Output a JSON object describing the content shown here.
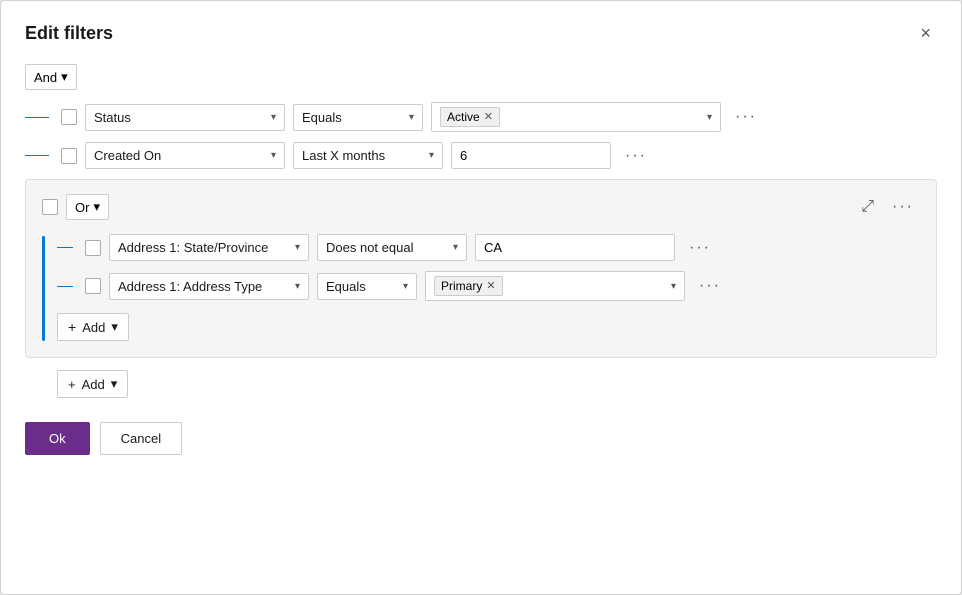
{
  "dialog": {
    "title": "Edit filters",
    "close_label": "×"
  },
  "and_group": {
    "label": "And",
    "chevron": "▾"
  },
  "filters": [
    {
      "id": "filter-status",
      "field": "Status",
      "condition": "Equals",
      "value_tag": "Active",
      "value_type": "tag"
    },
    {
      "id": "filter-created-on",
      "field": "Created On",
      "condition": "Last X months",
      "value_text": "6",
      "value_type": "text"
    }
  ],
  "or_group": {
    "label": "Or",
    "chevron": "▾",
    "collapse_icon": "⤢",
    "inner_filters": [
      {
        "id": "inner-filter-state",
        "field": "Address 1: State/Province",
        "condition": "Does not equal",
        "value_text": "CA",
        "value_type": "text"
      },
      {
        "id": "inner-filter-address-type",
        "field": "Address 1: Address Type",
        "condition": "Equals",
        "value_tag": "Primary",
        "value_type": "tag"
      }
    ],
    "add_label": "Add",
    "add_chevron": "▾"
  },
  "main_add": {
    "label": "Add",
    "chevron": "▾"
  },
  "footer": {
    "ok_label": "Ok",
    "cancel_label": "Cancel"
  }
}
